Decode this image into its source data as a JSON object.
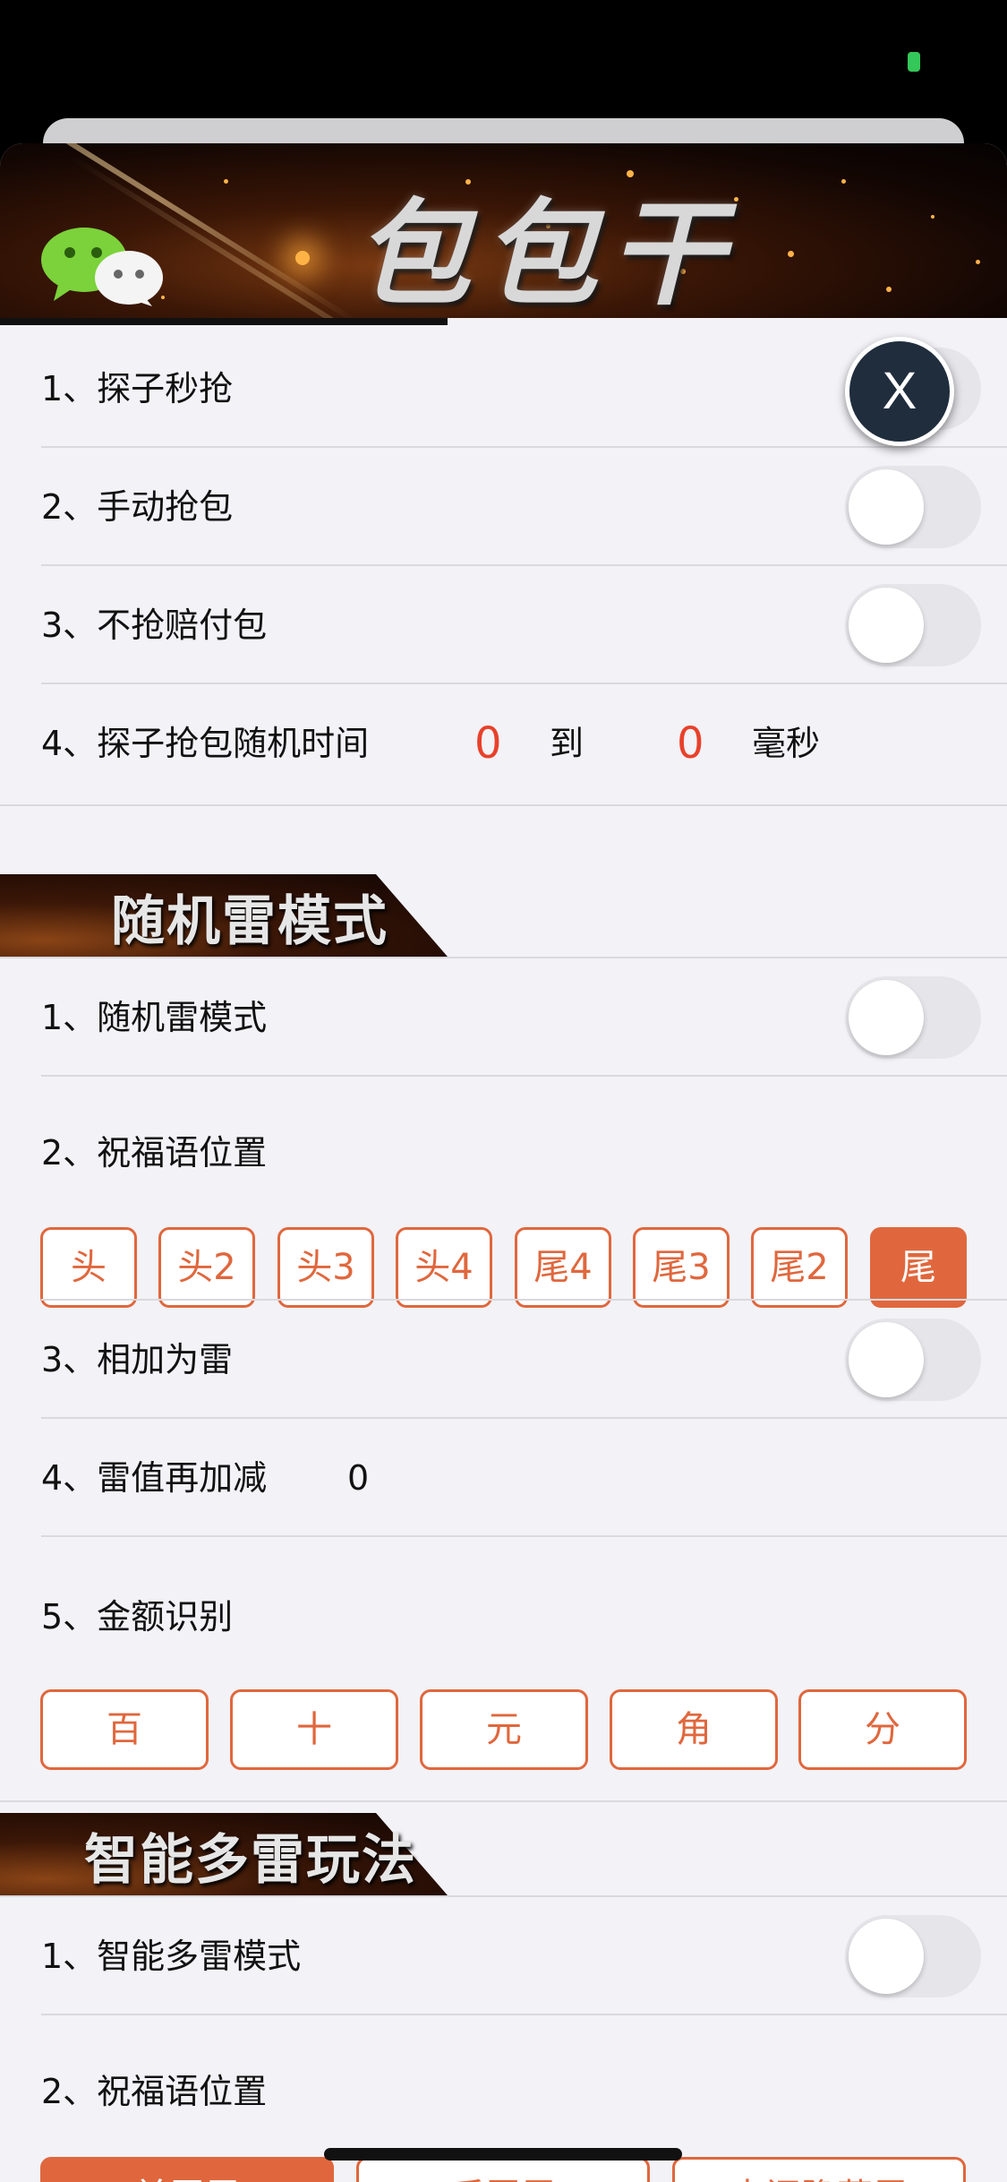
{
  "banner": {
    "title": "包包干",
    "logo": "wechat-logo"
  },
  "close_button": {
    "label": "X"
  },
  "general": {
    "rows": [
      {
        "label": "1、探子秒抢"
      },
      {
        "label": "2、手动抢包"
      },
      {
        "label": "3、不抢赔付包"
      },
      {
        "label": "4、探子抢包随机时间",
        "from": "0",
        "to_label": "到",
        "to": "0",
        "unit": "毫秒"
      }
    ]
  },
  "random_mine": {
    "header": "随机雷模式",
    "row1": "1、随机雷模式",
    "row2": "2、祝福语位置",
    "positions": [
      "头",
      "头2",
      "头3",
      "头4",
      "尾4",
      "尾3",
      "尾2",
      "尾"
    ],
    "selected_position": "尾",
    "row3": "3、相加为雷",
    "row4": "4、雷值再加减",
    "row4_value": "0",
    "row5": "5、金额识别",
    "amount_units": [
      "百",
      "十",
      "元",
      "角",
      "分"
    ]
  },
  "smart_mine": {
    "header": "智能多雷玩法",
    "row1": "1、智能多雷模式",
    "row2": "2、祝福语位置",
    "options": [
      "前置雷",
      "后置雷",
      "中间隐藏雷"
    ],
    "selected_option": "前置雷"
  },
  "colors": {
    "accent": "#e0673d",
    "value_red": "#e8412a",
    "toggle_off": "#e5e5ea",
    "background": "#f2f2f7"
  }
}
